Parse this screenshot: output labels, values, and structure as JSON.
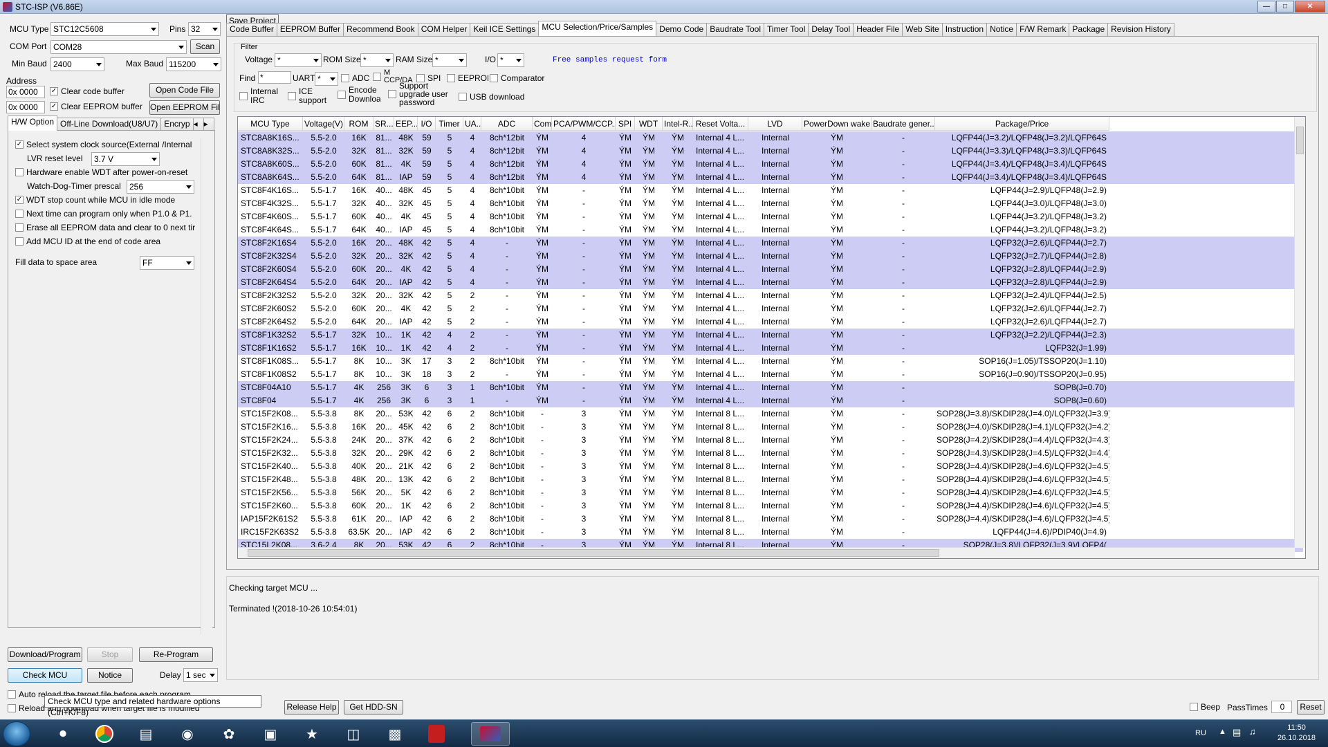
{
  "window": {
    "title": "STC-ISP (V6.86E)"
  },
  "left": {
    "mcu_type_label": "MCU Type",
    "mcu_type": "STC12C5608",
    "pins_label": "Pins",
    "pins": "32",
    "com_port_label": "COM Port",
    "com_port": "COM28",
    "scan": "Scan",
    "min_baud_label": "Min Baud",
    "min_baud": "2400",
    "max_baud_label": "Max Baud",
    "max_baud": "115200",
    "address_label": "Address",
    "addr1": "0x 0000",
    "clear_code": "Clear code buffer",
    "open_code": "Open Code File",
    "addr2": "0x 0000",
    "clear_eeprom": "Clear EEPROM buffer",
    "open_eeprom": "Open EEPROM File",
    "tabs": [
      "H/W Option",
      "Off-Line Download(U8/U7)",
      "Encryp"
    ],
    "opt_clock": "Select system clock source(External /Internal",
    "opt_lvr_label": "LVR reset level",
    "opt_lvr": "3.7 V",
    "opt_hw_wdt": "Hardware enable WDT after power-on-reset",
    "opt_wdt_prescal_label": "Watch-Dog-Timer prescal",
    "opt_wdt_prescal": "256",
    "opt_wdt_idle": "WDT stop count while MCU in idle mode",
    "opt_next_time": "Next time can program only when P1.0 & P1.",
    "opt_erase": "Erase all EEPROM data and clear to 0 next tir",
    "opt_mcu_id": "Add MCU ID at the end of code area",
    "fill_label": "Fill data to space area",
    "fill_value": "FF",
    "download": "Download/Program",
    "stop": "Stop",
    "reprogram": "Re-Program",
    "check_mcu": "Check MCU",
    "notice": "Notice",
    "delay_label": "Delay",
    "delay": "1 sec",
    "auto_reload": "Auto reload the target file before each program",
    "reload_download": "Reload and download when target file is modified",
    "save_project": "Save Project",
    "release_help": "Release Help",
    "get_hdd": "Get HDD-SN",
    "tooltip": "Check MCU type and related hardware options (Ctrl+K/F8)"
  },
  "tabs": [
    "Code Buffer",
    "EEPROM Buffer",
    "Recommend Book",
    "COM Helper",
    "Keil ICE Settings",
    "MCU Selection/Price/Samples",
    "Demo Code",
    "Baudrate Tool",
    "Timer Tool",
    "Delay Tool",
    "Header File",
    "Web Site",
    "Instruction",
    "Notice",
    "F/W Remark",
    "Package",
    "Revision History"
  ],
  "filter": {
    "title": "Filter",
    "voltage": "Voltage",
    "rom": "ROM Size",
    "ram": "RAM Size",
    "io": "I/O",
    "any": "*",
    "samples_link": "Free samples request form",
    "find": "Find",
    "find_value": "*",
    "uart": "UART",
    "adc": "ADC",
    "ccp": "M CCP/DA",
    "spi": "SPI",
    "eeprom": "EEPROM",
    "comparator": "Comparator",
    "internal_irc": "Internal IRC",
    "ice_support": "ICE support",
    "encode_download": "Encode Download",
    "support_upgrade": "Support upgrade user password",
    "usb_download": "USB download"
  },
  "table": {
    "headers": [
      "MCU Type",
      "Voltage(V)",
      "ROM",
      "SR...",
      "EEP...",
      "I/O",
      "Timer",
      "UA...",
      "ADC",
      "Comp",
      "PCA/PWM/CCP...",
      "SPI",
      "WDT",
      "Intel-R...",
      "Reset Volta...",
      "LVD",
      "PowerDown wake...",
      "Baudrate gener...",
      "Package/Price"
    ],
    "rows": [
      {
        "sel": true,
        "c": [
          "STC8A8K16S...",
          "5.5-2.0",
          "16K",
          "81...",
          "48K",
          "59",
          "5",
          "4",
          "8ch*12bit",
          "ÝМ",
          "4",
          "ÝМ",
          "ÝМ",
          "ÝМ",
          "Internal 4 L...",
          "Internal",
          "ÝМ",
          "-",
          "LQFP44(J=3.2)/LQFP48(J=3.2)/LQFP64S"
        ]
      },
      {
        "sel": true,
        "c": [
          "STC8A8K32S...",
          "5.5-2.0",
          "32K",
          "81...",
          "32K",
          "59",
          "5",
          "4",
          "8ch*12bit",
          "ÝМ",
          "4",
          "ÝМ",
          "ÝМ",
          "ÝМ",
          "Internal 4 L...",
          "Internal",
          "ÝМ",
          "-",
          "LQFP44(J=3.3)/LQFP48(J=3.3)/LQFP64S"
        ]
      },
      {
        "sel": true,
        "c": [
          "STC8A8K60S...",
          "5.5-2.0",
          "60K",
          "81...",
          "4K",
          "59",
          "5",
          "4",
          "8ch*12bit",
          "ÝМ",
          "4",
          "ÝМ",
          "ÝМ",
          "ÝМ",
          "Internal 4 L...",
          "Internal",
          "ÝМ",
          "-",
          "LQFP44(J=3.4)/LQFP48(J=3.4)/LQFP64S"
        ]
      },
      {
        "sel": true,
        "c": [
          "STC8A8K64S...",
          "5.5-2.0",
          "64K",
          "81...",
          "IAP",
          "59",
          "5",
          "4",
          "8ch*12bit",
          "ÝМ",
          "4",
          "ÝМ",
          "ÝМ",
          "ÝМ",
          "Internal 4 L...",
          "Internal",
          "ÝМ",
          "-",
          "LQFP44(J=3.4)/LQFP48(J=3.4)/LQFP64S"
        ]
      },
      {
        "sel": false,
        "c": [
          "STC8F4K16S...",
          "5.5-1.7",
          "16K",
          "40...",
          "48K",
          "45",
          "5",
          "4",
          "8ch*10bit",
          "ÝМ",
          "-",
          "ÝМ",
          "ÝМ",
          "ÝМ",
          "Internal 4 L...",
          "Internal",
          "ÝМ",
          "-",
          "LQFP44(J=2.9)/LQFP48(J=2.9)"
        ]
      },
      {
        "sel": false,
        "c": [
          "STC8F4K32S...",
          "5.5-1.7",
          "32K",
          "40...",
          "32K",
          "45",
          "5",
          "4",
          "8ch*10bit",
          "ÝМ",
          "-",
          "ÝМ",
          "ÝМ",
          "ÝМ",
          "Internal 4 L...",
          "Internal",
          "ÝМ",
          "-",
          "LQFP44(J=3.0)/LQFP48(J=3.0)"
        ]
      },
      {
        "sel": false,
        "c": [
          "STC8F4K60S...",
          "5.5-1.7",
          "60K",
          "40...",
          "4K",
          "45",
          "5",
          "4",
          "8ch*10bit",
          "ÝМ",
          "-",
          "ÝМ",
          "ÝМ",
          "ÝМ",
          "Internal 4 L...",
          "Internal",
          "ÝМ",
          "-",
          "LQFP44(J=3.2)/LQFP48(J=3.2)"
        ]
      },
      {
        "sel": false,
        "c": [
          "STC8F4K64S...",
          "5.5-1.7",
          "64K",
          "40...",
          "IAP",
          "45",
          "5",
          "4",
          "8ch*10bit",
          "ÝМ",
          "-",
          "ÝМ",
          "ÝМ",
          "ÝМ",
          "Internal 4 L...",
          "Internal",
          "ÝМ",
          "-",
          "LQFP44(J=3.2)/LQFP48(J=3.2)"
        ]
      },
      {
        "sel": true,
        "c": [
          "STC8F2K16S4",
          "5.5-2.0",
          "16K",
          "20...",
          "48K",
          "42",
          "5",
          "4",
          "-",
          "ÝМ",
          "-",
          "ÝМ",
          "ÝМ",
          "ÝМ",
          "Internal 4 L...",
          "Internal",
          "ÝМ",
          "-",
          "LQFP32(J=2.6)/LQFP44(J=2.7)"
        ]
      },
      {
        "sel": true,
        "c": [
          "STC8F2K32S4",
          "5.5-2.0",
          "32K",
          "20...",
          "32K",
          "42",
          "5",
          "4",
          "-",
          "ÝМ",
          "-",
          "ÝМ",
          "ÝМ",
          "ÝМ",
          "Internal 4 L...",
          "Internal",
          "ÝМ",
          "-",
          "LQFP32(J=2.7)/LQFP44(J=2.8)"
        ]
      },
      {
        "sel": true,
        "c": [
          "STC8F2K60S4",
          "5.5-2.0",
          "60K",
          "20...",
          "4K",
          "42",
          "5",
          "4",
          "-",
          "ÝМ",
          "-",
          "ÝМ",
          "ÝМ",
          "ÝМ",
          "Internal 4 L...",
          "Internal",
          "ÝМ",
          "-",
          "LQFP32(J=2.8)/LQFP44(J=2.9)"
        ]
      },
      {
        "sel": true,
        "c": [
          "STC8F2K64S4",
          "5.5-2.0",
          "64K",
          "20...",
          "IAP",
          "42",
          "5",
          "4",
          "-",
          "ÝМ",
          "-",
          "ÝМ",
          "ÝМ",
          "ÝМ",
          "Internal 4 L...",
          "Internal",
          "ÝМ",
          "-",
          "LQFP32(J=2.8)/LQFP44(J=2.9)"
        ]
      },
      {
        "sel": false,
        "c": [
          "STC8F2K32S2",
          "5.5-2.0",
          "32K",
          "20...",
          "32K",
          "42",
          "5",
          "2",
          "-",
          "ÝМ",
          "-",
          "ÝМ",
          "ÝМ",
          "ÝМ",
          "Internal 4 L...",
          "Internal",
          "ÝМ",
          "-",
          "LQFP32(J=2.4)/LQFP44(J=2.5)"
        ]
      },
      {
        "sel": false,
        "c": [
          "STC8F2K60S2",
          "5.5-2.0",
          "60K",
          "20...",
          "4K",
          "42",
          "5",
          "2",
          "-",
          "ÝМ",
          "-",
          "ÝМ",
          "ÝМ",
          "ÝМ",
          "Internal 4 L...",
          "Internal",
          "ÝМ",
          "-",
          "LQFP32(J=2.6)/LQFP44(J=2.7)"
        ]
      },
      {
        "sel": false,
        "c": [
          "STC8F2K64S2",
          "5.5-2.0",
          "64K",
          "20...",
          "IAP",
          "42",
          "5",
          "2",
          "-",
          "ÝМ",
          "-",
          "ÝМ",
          "ÝМ",
          "ÝМ",
          "Internal 4 L...",
          "Internal",
          "ÝМ",
          "-",
          "LQFP32(J=2.6)/LQFP44(J=2.7)"
        ]
      },
      {
        "sel": true,
        "c": [
          "STC8F1K32S2",
          "5.5-1.7",
          "32K",
          "10...",
          "1K",
          "42",
          "4",
          "2",
          "-",
          "ÝМ",
          "-",
          "ÝМ",
          "ÝМ",
          "ÝМ",
          "Internal 4 L...",
          "Internal",
          "ÝМ",
          "-",
          "LQFP32(J=2.2)/LQFP44(J=2.3)"
        ]
      },
      {
        "sel": true,
        "c": [
          "STC8F1K16S2",
          "5.5-1.7",
          "16K",
          "10...",
          "1K",
          "42",
          "4",
          "2",
          "-",
          "ÝМ",
          "-",
          "ÝМ",
          "ÝМ",
          "ÝМ",
          "Internal 4 L...",
          "Internal",
          "ÝМ",
          "-",
          "LQFP32(J=1.99)"
        ]
      },
      {
        "sel": false,
        "c": [
          "STC8F1K08S...",
          "5.5-1.7",
          "8K",
          "10...",
          "3K",
          "17",
          "3",
          "2",
          "8ch*10bit",
          "ÝМ",
          "-",
          "ÝМ",
          "ÝМ",
          "ÝМ",
          "Internal 4 L...",
          "Internal",
          "ÝМ",
          "-",
          "SOP16(J=1.05)/TSSOP20(J=1.10)"
        ]
      },
      {
        "sel": false,
        "c": [
          "STC8F1K08S2",
          "5.5-1.7",
          "8K",
          "10...",
          "3K",
          "18",
          "3",
          "2",
          "-",
          "ÝМ",
          "-",
          "ÝМ",
          "ÝМ",
          "ÝМ",
          "Internal 4 L...",
          "Internal",
          "ÝМ",
          "-",
          "SOP16(J=0.90)/TSSOP20(J=0.95)"
        ]
      },
      {
        "sel": true,
        "c": [
          "STC8F04A10",
          "5.5-1.7",
          "4K",
          "256",
          "3K",
          "6",
          "3",
          "1",
          "8ch*10bit",
          "ÝМ",
          "-",
          "ÝМ",
          "ÝМ",
          "ÝМ",
          "Internal 4 L...",
          "Internal",
          "ÝМ",
          "-",
          "SOP8(J=0.70)"
        ]
      },
      {
        "sel": true,
        "c": [
          "STC8F04",
          "5.5-1.7",
          "4K",
          "256",
          "3K",
          "6",
          "3",
          "1",
          "-",
          "ÝМ",
          "-",
          "ÝМ",
          "ÝМ",
          "ÝМ",
          "Internal 4 L...",
          "Internal",
          "ÝМ",
          "-",
          "SOP8(J=0.60)"
        ]
      },
      {
        "sel": false,
        "c": [
          "STC15F2K08...",
          "5.5-3.8",
          "8K",
          "20...",
          "53K",
          "42",
          "6",
          "2",
          "8ch*10bit",
          "-",
          "3",
          "ÝМ",
          "ÝМ",
          "ÝМ",
          "Internal 8 L...",
          "Internal",
          "ÝМ",
          "-",
          "SOP28(J=3.8)/SKDIP28(J=4.0)/LQFP32(J=3.9)/LQFP44"
        ]
      },
      {
        "sel": false,
        "c": [
          "STC15F2K16...",
          "5.5-3.8",
          "16K",
          "20...",
          "45K",
          "42",
          "6",
          "2",
          "8ch*10bit",
          "-",
          "3",
          "ÝМ",
          "ÝМ",
          "ÝМ",
          "Internal 8 L...",
          "Internal",
          "ÝМ",
          "-",
          "SOP28(J=4.0)/SKDIP28(J=4.1)/LQFP32(J=4.2)/LQFP44"
        ]
      },
      {
        "sel": false,
        "c": [
          "STC15F2K24...",
          "5.5-3.8",
          "24K",
          "20...",
          "37K",
          "42",
          "6",
          "2",
          "8ch*10bit",
          "-",
          "3",
          "ÝМ",
          "ÝМ",
          "ÝМ",
          "Internal 8 L...",
          "Internal",
          "ÝМ",
          "-",
          "SOP28(J=4.2)/SKDIP28(J=4.4)/LQFP32(J=4.3)/LQFP44"
        ]
      },
      {
        "sel": false,
        "c": [
          "STC15F2K32...",
          "5.5-3.8",
          "32K",
          "20...",
          "29K",
          "42",
          "6",
          "2",
          "8ch*10bit",
          "-",
          "3",
          "ÝМ",
          "ÝМ",
          "ÝМ",
          "Internal 8 L...",
          "Internal",
          "ÝМ",
          "-",
          "SOP28(J=4.3)/SKDIP28(J=4.5)/LQFP32(J=4.4)/LQFP44"
        ]
      },
      {
        "sel": false,
        "c": [
          "STC15F2K40...",
          "5.5-3.8",
          "40K",
          "20...",
          "21K",
          "42",
          "6",
          "2",
          "8ch*10bit",
          "-",
          "3",
          "ÝМ",
          "ÝМ",
          "ÝМ",
          "Internal 8 L...",
          "Internal",
          "ÝМ",
          "-",
          "SOP28(J=4.4)/SKDIP28(J=4.6)/LQFP32(J=4.5)/LQFP44"
        ]
      },
      {
        "sel": false,
        "c": [
          "STC15F2K48...",
          "5.5-3.8",
          "48K",
          "20...",
          "13K",
          "42",
          "6",
          "2",
          "8ch*10bit",
          "-",
          "3",
          "ÝМ",
          "ÝМ",
          "ÝМ",
          "Internal 8 L...",
          "Internal",
          "ÝМ",
          "-",
          "SOP28(J=4.4)/SKDIP28(J=4.6)/LQFP32(J=4.5)/LQFP44"
        ]
      },
      {
        "sel": false,
        "c": [
          "STC15F2K56...",
          "5.5-3.8",
          "56K",
          "20...",
          "5K",
          "42",
          "6",
          "2",
          "8ch*10bit",
          "-",
          "3",
          "ÝМ",
          "ÝМ",
          "ÝМ",
          "Internal 8 L...",
          "Internal",
          "ÝМ",
          "-",
          "SOP28(J=4.4)/SKDIP28(J=4.6)/LQFP32(J=4.5)/LQFP44"
        ]
      },
      {
        "sel": false,
        "c": [
          "STC15F2K60...",
          "5.5-3.8",
          "60K",
          "20...",
          "1K",
          "42",
          "6",
          "2",
          "8ch*10bit",
          "-",
          "3",
          "ÝМ",
          "ÝМ",
          "ÝМ",
          "Internal 8 L...",
          "Internal",
          "ÝМ",
          "-",
          "SOP28(J=4.4)/SKDIP28(J=4.6)/LQFP32(J=4.5)/LQFP44"
        ]
      },
      {
        "sel": false,
        "c": [
          "IAP15F2K61S2",
          "5.5-3.8",
          "61K",
          "20...",
          "IAP",
          "42",
          "6",
          "2",
          "8ch*10bit",
          "-",
          "3",
          "ÝМ",
          "ÝМ",
          "ÝМ",
          "Internal 8 L...",
          "Internal",
          "ÝМ",
          "-",
          "SOP28(J=4.4)/SKDIP28(J=4.6)/LQFP32(J=4.5)/LQFP44"
        ]
      },
      {
        "sel": false,
        "c": [
          "IRC15F2K63S2",
          "5.5-3.8",
          "63.5K",
          "20...",
          "IAP",
          "42",
          "6",
          "2",
          "8ch*10bit",
          "-",
          "3",
          "ÝМ",
          "ÝМ",
          "ÝМ",
          "Internal 8 L...",
          "Internal",
          "ÝМ",
          "-",
          "LQFP44(J=4.6)/PDIP40(J=4.9)"
        ]
      },
      {
        "sel": true,
        "c": [
          "STC15L2K08...",
          "3.6-2.4",
          "8K",
          "20...",
          "53K",
          "42",
          "6",
          "2",
          "8ch*10bit",
          "-",
          "3",
          "ÝМ",
          "ÝМ",
          "ÝМ",
          "Internal 8 L...",
          "Internal",
          "ÝМ",
          "-",
          "SOP28(J=3.8)/LQFP32(J=3.9)/LQFP4("
        ]
      }
    ]
  },
  "log": {
    "line1": "Checking target MCU ...",
    "line2": "Terminated !(2018-10-26 10:54:01)"
  },
  "status": {
    "beep": "Beep",
    "pass_label": "PassTimes",
    "pass_value": "0",
    "reset": "Reset"
  },
  "taskbar": {
    "lang": "RU",
    "time": "11:50",
    "date": "26.10.2018"
  }
}
